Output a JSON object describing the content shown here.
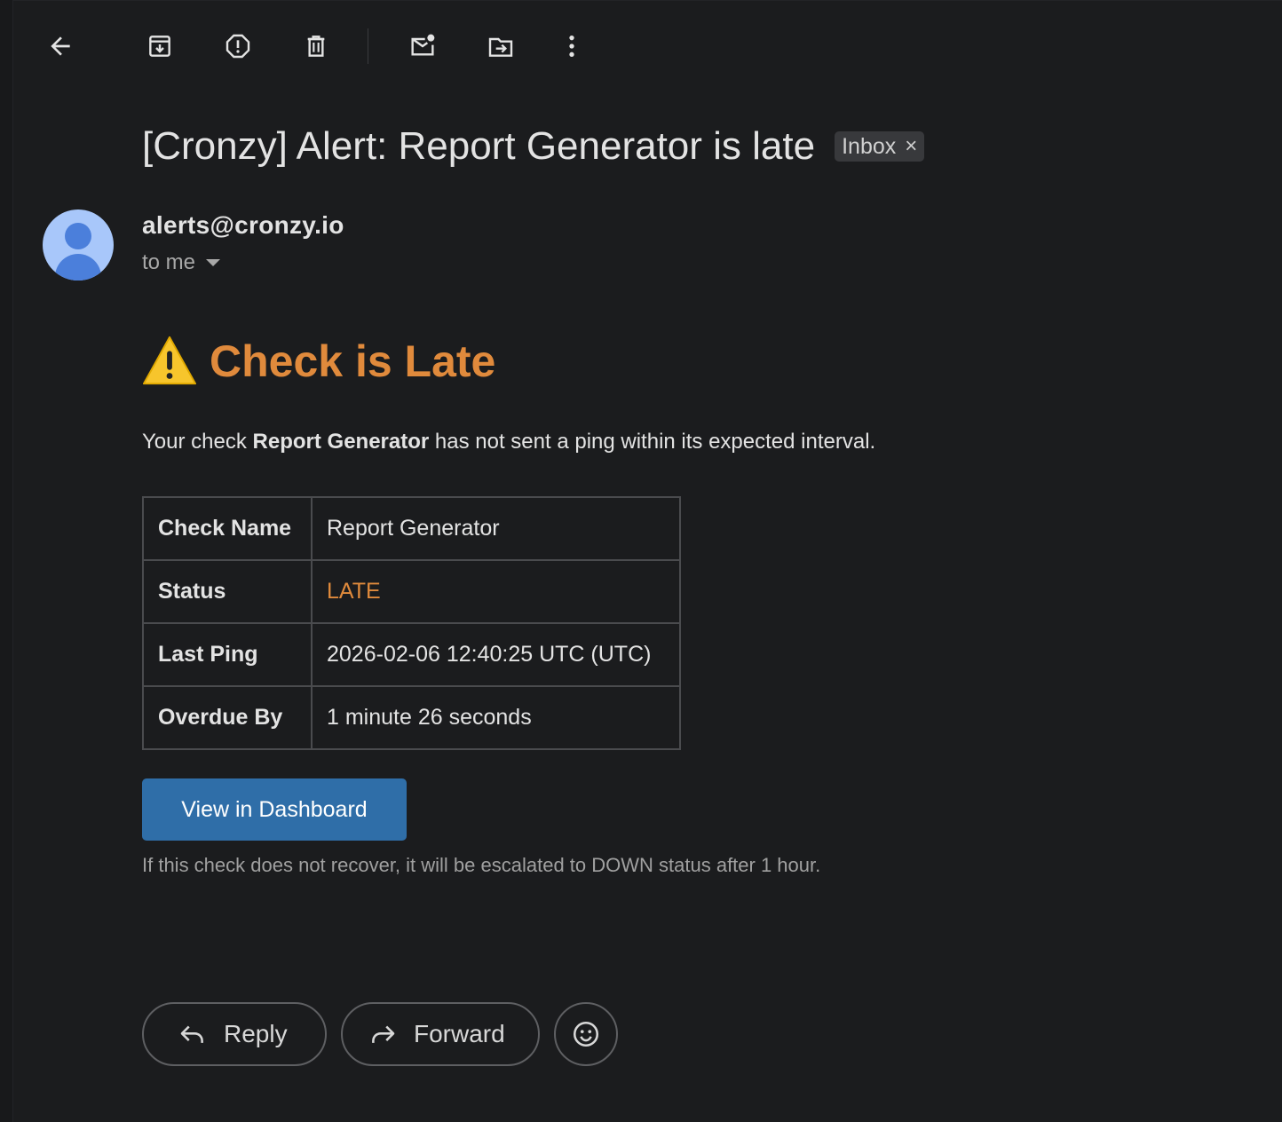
{
  "toolbar": {
    "back": "back-arrow-icon",
    "actions": [
      "archive-icon",
      "report-spam-icon",
      "delete-icon",
      "mark-unread-icon",
      "move-to-icon",
      "more-vert-icon"
    ]
  },
  "email": {
    "subject": "[Cronzy] Alert: Report Generator is late",
    "label_chip": "Inbox",
    "label_remove": "×",
    "sender": "alerts@cronzy.io",
    "recipient": "to me"
  },
  "body": {
    "headline_icon": "⚠️",
    "headline": "Check is Late",
    "intro_prefix": "Your check ",
    "intro_check": "Report Generator",
    "intro_suffix": " has not sent a ping within its expected interval.",
    "details": [
      {
        "label": "Check Name",
        "value": "Report Generator"
      },
      {
        "label": "Status",
        "value": "LATE"
      },
      {
        "label": "Last Ping",
        "value": "2026-02-06 12:40:25 UTC (UTC)"
      },
      {
        "label": "Overdue By",
        "value": "1 minute 26 seconds"
      }
    ],
    "cta_label": "View in Dashboard",
    "footnote": "If this check does not recover, it will be escalated to DOWN status after 1 hour."
  },
  "actions": {
    "reply": "Reply",
    "forward": "Forward"
  },
  "colors": {
    "background": "#1b1c1e",
    "accent_late": "#e08a3c",
    "cta": "#2f6ea8",
    "avatar": "#a8c7fa"
  }
}
